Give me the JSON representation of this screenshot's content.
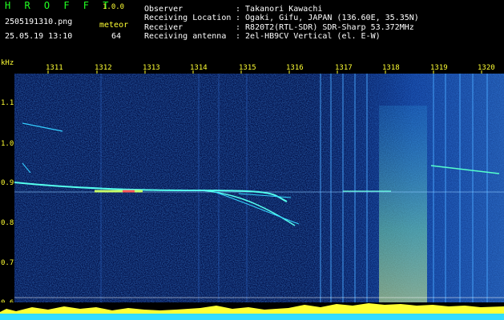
{
  "header": {
    "app_name": "H R O F F T",
    "version": "1.0.0",
    "filename": "2505191310.png",
    "datetime": "25.05.19 13:10",
    "meteor_label": "meteor",
    "meteor_count": "64",
    "observer_label": "Observer",
    "observer_value": ": Takanori Kawachi",
    "location_label": "Receiving Location",
    "location_value": ": Ogaki, Gifu, JAPAN (136.60E, 35.35N)",
    "receiver_label": "Receiver",
    "receiver_value": ": R820T2(RTL-SDR) SDR-Sharp 53.372MHz",
    "antenna_label": "Receiving antenna",
    "antenna_value": ": 2el-HB9CV Vertical (el. E-W)"
  },
  "axis": {
    "y_unit": "kHz",
    "y_ticks": [
      "1.1",
      "1.0",
      "0.9",
      "0.8",
      "0.7",
      "0.6"
    ],
    "x_ticks": [
      "1311",
      "1312",
      "1313",
      "1314",
      "1315",
      "1316",
      "1317",
      "1318",
      "1319",
      "1320"
    ]
  },
  "colors": {
    "background": "#000000",
    "label_yellow": "#ffff33",
    "brand_green": "#22ff22",
    "signal_cyan": "#33ffff",
    "noise_blue": "#0a3aa8"
  }
}
